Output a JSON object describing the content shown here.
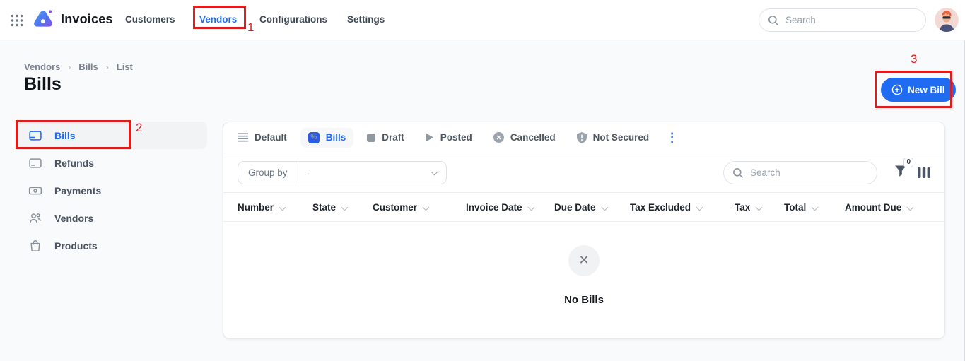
{
  "colors": {
    "accent": "#1f6bf2",
    "annotation": "#dc1d1d",
    "active_tab_icon": "#2b59e8"
  },
  "app": {
    "title": "Invoices"
  },
  "nav": {
    "items": [
      {
        "label": "Customers",
        "active": false
      },
      {
        "label": "Vendors",
        "active": true
      },
      {
        "label": "Configurations",
        "active": false
      },
      {
        "label": "Settings",
        "active": false
      }
    ]
  },
  "topbar": {
    "search_placeholder": "Search"
  },
  "breadcrumb": {
    "items": [
      "Vendors",
      "Bills",
      "List"
    ],
    "separator": "›"
  },
  "page": {
    "title": "Bills",
    "new_button_label": "New Bill"
  },
  "sidebar": {
    "items": [
      {
        "label": "Bills",
        "icon": "bill-card-icon",
        "active": true
      },
      {
        "label": "Refunds",
        "icon": "refund-card-icon",
        "active": false
      },
      {
        "label": "Payments",
        "icon": "banknote-icon",
        "active": false
      },
      {
        "label": "Vendors",
        "icon": "people-icon",
        "active": false
      },
      {
        "label": "Products",
        "icon": "shopping-bag-icon",
        "active": false
      }
    ]
  },
  "filters": {
    "tabs": [
      {
        "label": "Default",
        "icon": "lines-icon",
        "active": false
      },
      {
        "label": "Bills",
        "icon": "percent-badge-icon",
        "active": true
      },
      {
        "label": "Draft",
        "icon": "square-icon",
        "active": false
      },
      {
        "label": "Posted",
        "icon": "play-icon",
        "active": false
      },
      {
        "label": "Cancelled",
        "icon": "circle-x-icon",
        "active": false
      },
      {
        "label": "Not Secured",
        "icon": "shield-alert-icon",
        "active": false
      }
    ],
    "more_glyph": "⋮"
  },
  "toolbar": {
    "group_by_label": "Group by",
    "group_by_value": "-",
    "search_placeholder": "Search",
    "filter_count": "0"
  },
  "table": {
    "columns": [
      {
        "label": "Number"
      },
      {
        "label": "State"
      },
      {
        "label": "Customer"
      },
      {
        "label": "Invoice Date"
      },
      {
        "label": "Due Date"
      },
      {
        "label": "Tax Excluded"
      },
      {
        "label": "Tax"
      },
      {
        "label": "Total"
      },
      {
        "label": "Amount Due"
      }
    ]
  },
  "empty_state": {
    "message": "No Bills",
    "glyph": "✕"
  },
  "glyphs": {
    "percent": "%"
  },
  "annotations": {
    "labels": [
      "1",
      "2",
      "3"
    ]
  }
}
